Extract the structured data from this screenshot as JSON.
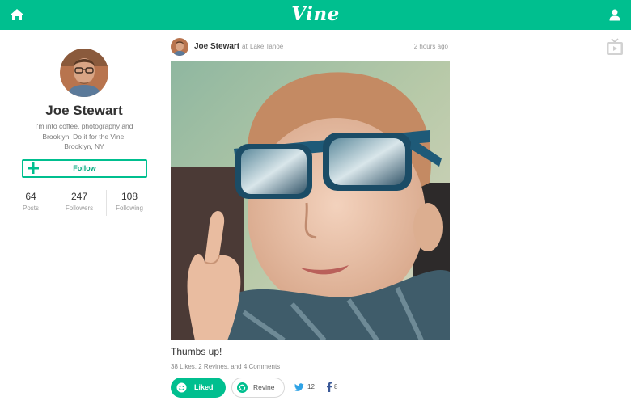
{
  "app": {
    "logo_text": "Vine",
    "brand_color": "#00bf8f"
  },
  "nav": {
    "home_icon": "home-icon",
    "profile_icon": "person-icon",
    "tv_icon": "tv-icon"
  },
  "profile": {
    "name": "Joe Stewart",
    "bio_line1": "I'm into coffee, photography and",
    "bio_line2": "Brooklyn. Do it for the Vine!",
    "bio_line3": "Brooklyn, NY",
    "follow_label": "Follow",
    "stats": [
      {
        "value": "64",
        "label": "Posts"
      },
      {
        "value": "247",
        "label": "Followers"
      },
      {
        "value": "108",
        "label": "Following"
      }
    ]
  },
  "post": {
    "author": "Joe Stewart",
    "location_prefix": "at",
    "location": "Lake Tahoe",
    "time": "2 hours ago",
    "caption": "Thumbs up!",
    "counts": "38 Likes, 2 Revines, and 4 Comments",
    "liked_label": "Liked",
    "revine_label": "Revine",
    "twitter_count": "12",
    "facebook_count": "8"
  }
}
